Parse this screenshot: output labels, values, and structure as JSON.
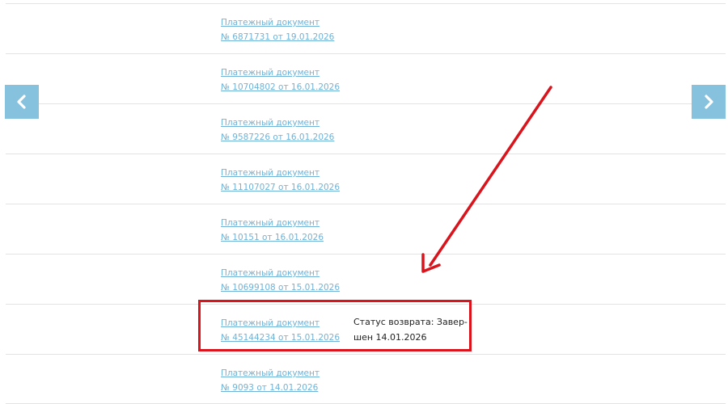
{
  "documents": [
    {
      "title": "Платежный документ",
      "number": "№ 6871731 от 19.01.2026"
    },
    {
      "title": "Платежный документ",
      "number": "№ 10704802 от 16.01.2026"
    },
    {
      "title": "Платежный документ",
      "number": "№ 9587226 от 16.01.2026"
    },
    {
      "title": "Платежный документ",
      "number": "№ 11107027 от 16.01.2026"
    },
    {
      "title": "Платежный документ",
      "number": "№ 10151 от 16.01.2026"
    },
    {
      "title": "Платежный документ",
      "number": "№ 10699108 от 15.01.2026"
    },
    {
      "title": "Платежный документ",
      "number": "№ 45144234 от 15.01.2026"
    },
    {
      "title": "Платежный документ",
      "number": "№ 9093 от 14.01.2026"
    }
  ],
  "refund_status": {
    "line1": "Статус возврата: Завер-",
    "line2": "шен 14.01.2026"
  },
  "nav": {
    "prev_icon": "chevron-left-icon",
    "next_icon": "chevron-right-icon"
  },
  "colors": {
    "link": "#6fb3d9",
    "nav_button": "#86c1dd",
    "annotation": "#d9141c"
  }
}
